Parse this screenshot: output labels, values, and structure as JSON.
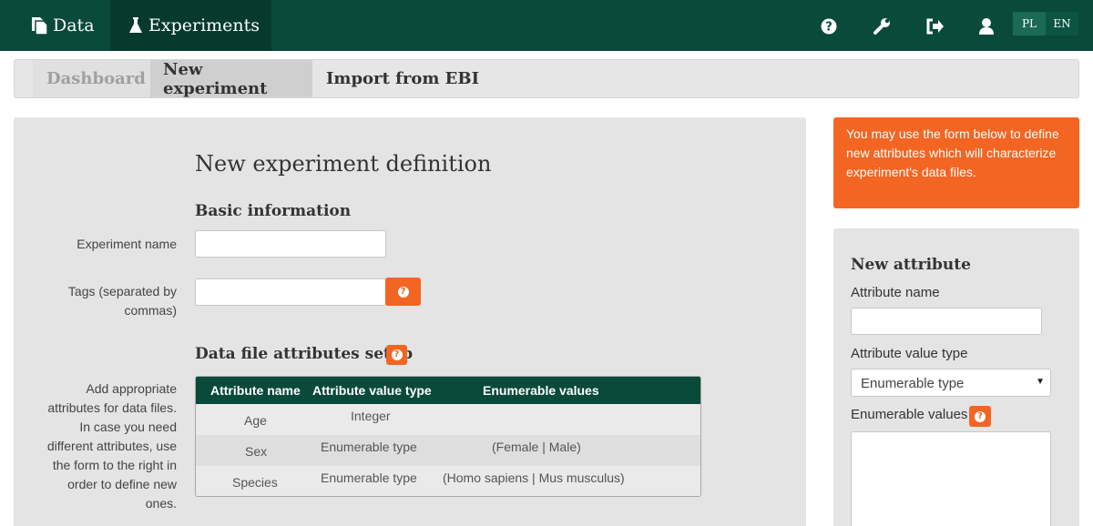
{
  "topbar": {
    "tabs": [
      {
        "label": "Data",
        "icon": "files-icon"
      },
      {
        "label": "Experiments",
        "icon": "flask-icon"
      }
    ],
    "icons": [
      "help-icon",
      "wrench-icon",
      "logout-icon",
      "user-icon"
    ],
    "languages": [
      "PL",
      "EN"
    ],
    "colors": {
      "navbar": "#0a4a3a",
      "active_tab": "#063a2d",
      "accent": "#f26522"
    }
  },
  "breadcrumb": {
    "tabs": [
      {
        "label": "Dashboard",
        "state": "disabled"
      },
      {
        "label": "New experiment",
        "state": "active"
      },
      {
        "label": "Import from EBI",
        "state": "normal"
      }
    ]
  },
  "form": {
    "title": "New experiment definition",
    "basic_section": "Basic information",
    "experiment_name_label": "Experiment name",
    "experiment_name_value": "",
    "tags_label_line1": "Tags (separated by",
    "tags_label_line2": "commas)",
    "tags_value": "",
    "attributes_section": "Data file attributes setup",
    "attributes_help": [
      "Add appropriate",
      "attributes for data files.",
      "In case you need",
      "different attributes, use",
      "the form to the right in",
      "order to define new",
      "ones."
    ],
    "table": {
      "headers": [
        "Attribute name",
        "Attribute value type",
        "Enumerable values"
      ],
      "rows": [
        {
          "name": "Age",
          "type": "Integer",
          "values": ""
        },
        {
          "name": "Sex",
          "type": "Enumerable type",
          "values": "(Female | Male)"
        },
        {
          "name": "Species",
          "type": "Enumerable type",
          "values": "(Homo sapiens | Mus musculus)"
        }
      ]
    }
  },
  "sidebar": {
    "notice": "You may use the form below to define new attributes which will characterize experiment's data files.",
    "title": "New attribute",
    "attribute_name_label": "Attribute name",
    "attribute_name_value": "",
    "value_type_label": "Attribute value type",
    "value_type_selected": "Enumerable type",
    "enumerable_values_label": "Enumerable values",
    "enumerable_values_value": ""
  }
}
